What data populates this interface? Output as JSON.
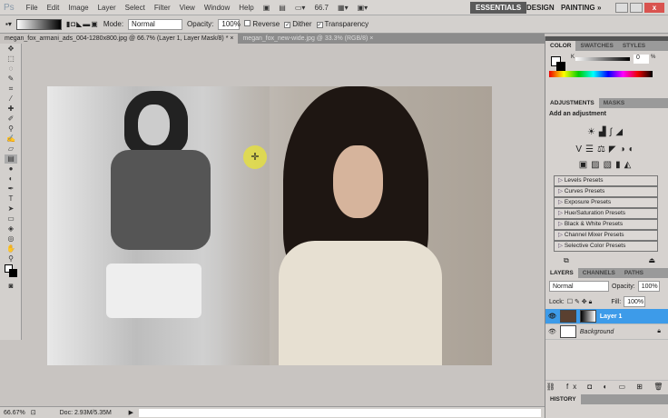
{
  "app": {
    "logo": "Ps",
    "menu": [
      "File",
      "Edit",
      "Image",
      "Layer",
      "Select",
      "Filter",
      "View",
      "Window",
      "Help"
    ],
    "zoom": "66.7",
    "workspaces": [
      "ESSENTIALS",
      "DESIGN",
      "PAINTING",
      "»"
    ]
  },
  "options": {
    "mode_label": "Mode:",
    "mode_value": "Normal",
    "opacity_label": "Opacity:",
    "opacity_value": "100%",
    "reverse": "Reverse",
    "dither": "Dither",
    "transparency": "Transparency"
  },
  "tabs": [
    {
      "label": "megan_fox_armani_ads_004-1280x800.jpg @ 66.7% (Layer 1, Layer Mask/8) *"
    },
    {
      "label": "megan_fox_new-wide.jpg @ 33.3% (RGB/8)"
    }
  ],
  "status": {
    "zoom": "66.67%",
    "doc": "Doc: 2.93M/5.35M"
  },
  "color_panel": {
    "tabs": [
      "COLOR",
      "SWATCHES",
      "STYLES"
    ],
    "channel": "K",
    "value": "0",
    "unit": "%"
  },
  "adjustments": {
    "tabs": [
      "ADJUSTMENTS",
      "MASKS"
    ],
    "title": "Add an adjustment",
    "presets": [
      "Levels Presets",
      "Curves Presets",
      "Exposure Presets",
      "Hue/Saturation Presets",
      "Black & White Presets",
      "Channel Mixer Presets",
      "Selective Color Presets"
    ]
  },
  "layers": {
    "tabs": [
      "LAYERS",
      "CHANNELS",
      "PATHS"
    ],
    "blend": "Normal",
    "opacity_label": "Opacity:",
    "opacity": "100%",
    "lock_label": "Lock:",
    "fill_label": "Fill:",
    "fill": "100%",
    "items": [
      {
        "name": "Layer 1"
      },
      {
        "name": "Background"
      }
    ]
  },
  "history": {
    "title": "HISTORY"
  }
}
